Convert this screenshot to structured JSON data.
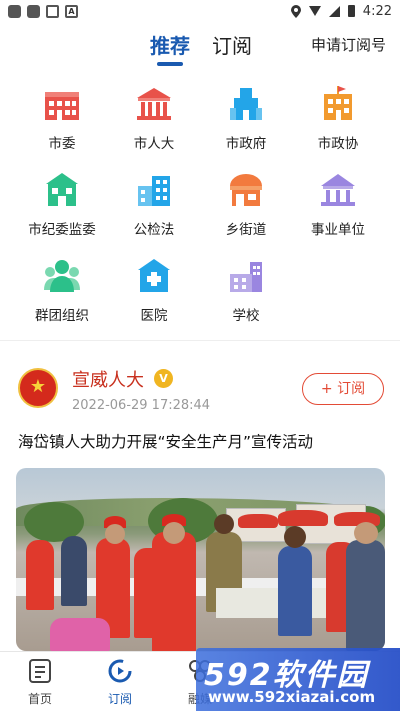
{
  "status_bar": {
    "time": "4:22",
    "left_icons": [
      "app-icon",
      "app-icon",
      "image-icon",
      "a-icon"
    ],
    "right_icons": [
      "location-icon",
      "wifi-icon",
      "signal-icon",
      "battery-icon"
    ]
  },
  "header": {
    "tabs": [
      {
        "label": "推荐",
        "active": true
      },
      {
        "label": "订阅",
        "active": false
      }
    ],
    "apply_label": "申请订阅号"
  },
  "categories": [
    {
      "label": "市委",
      "icon": "building-icon",
      "color": "#e8524a"
    },
    {
      "label": "市人大",
      "icon": "hall-icon",
      "color": "#e8524a"
    },
    {
      "label": "市政府",
      "icon": "tower-icon",
      "color": "#23a5e8"
    },
    {
      "label": "市政协",
      "icon": "flag-building-icon",
      "color": "#f29a2e"
    },
    {
      "label": "市纪委监委",
      "icon": "house-icon",
      "color": "#2cc08a"
    },
    {
      "label": "公检法",
      "icon": "office-icon",
      "color": "#23a5e8"
    },
    {
      "label": "乡街道",
      "icon": "shop-icon",
      "color": "#f27a3e"
    },
    {
      "label": "事业单位",
      "icon": "institution-icon",
      "color": "#9a86e0"
    },
    {
      "label": "群团组织",
      "icon": "people-icon",
      "color": "#2cc08a"
    },
    {
      "label": "医院",
      "icon": "hospital-icon",
      "color": "#23a5e8"
    },
    {
      "label": "学校",
      "icon": "school-icon",
      "color": "#9a86e0"
    }
  ],
  "article": {
    "author": "宣威人大",
    "verified_badge": "V",
    "time": "2022-06-29 17:28:44",
    "follow_label": "+ 订阅",
    "title": "海岱镇人大助力开展“安全生产月”宣传活动"
  },
  "bottom_nav": [
    {
      "label": "首页",
      "icon": "home-icon",
      "active": false
    },
    {
      "label": "订阅",
      "icon": "subscribe-icon",
      "active": true
    },
    {
      "label": "融媒",
      "icon": "media-icon",
      "active": false
    }
  ],
  "watermark": {
    "text": "592软件园",
    "url": "www.592xiazai.com"
  },
  "colors": {
    "accent": "#1a5ab0",
    "author_red": "#c8301e",
    "follow_red": "#e34b36"
  }
}
